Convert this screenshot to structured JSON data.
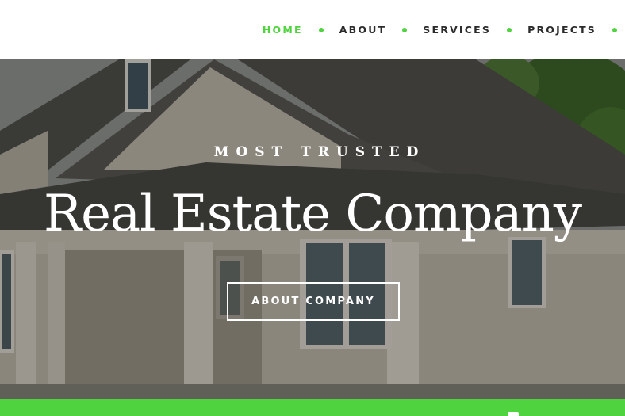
{
  "nav": {
    "items": [
      {
        "label": "HOME",
        "active": true
      },
      {
        "label": "ABOUT",
        "active": false
      },
      {
        "label": "SERVICES",
        "active": false
      },
      {
        "label": "PROJECTS",
        "active": false
      }
    ]
  },
  "hero": {
    "eyebrow": "MOST TRUSTED",
    "headline": "Real Estate Company",
    "cta_label": "ABOUT COMPANY"
  },
  "colors": {
    "accent": "#4fd33e",
    "nav_text": "#2b2b2b",
    "hero_text": "#ffffff"
  }
}
